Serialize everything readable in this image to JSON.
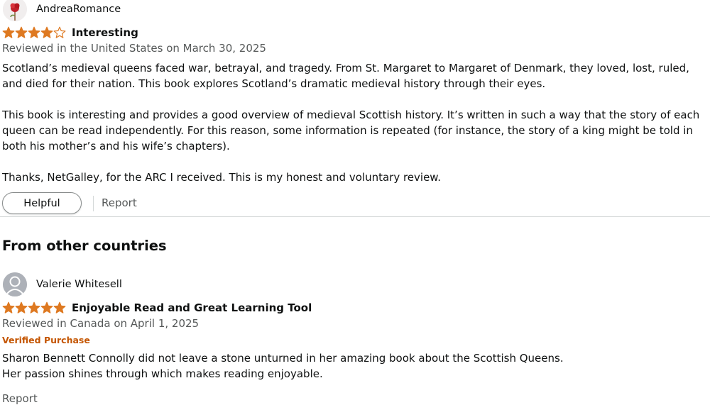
{
  "reviews": [
    {
      "reviewer": "AndreaRomance",
      "rating": 4,
      "max_rating": 5,
      "title": "Interesting",
      "date_line": "Reviewed in the United States on March 30, 2025",
      "paragraphs": [
        "Scotland’s medieval queens faced war, betrayal, and tragedy. From St. Margaret to Margaret of Denmark, they loved, lost, ruled, and died for their nation. This book explores Scotland’s dramatic medieval history through their eyes.",
        "This book is interesting and provides a good overview of medieval Scottish history. It’s written in such a way that the story of each queen can be read independently. For this reason, some information is repeated (for instance, the story of a king might be told in both his mother’s and his wife’s chapters).",
        "Thanks, NetGalley, for the ARC I received. This is my honest and voluntary review."
      ],
      "helpful_label": "Helpful",
      "report_label": "Report"
    },
    {
      "reviewer": "Valerie Whitesell",
      "rating": 5,
      "max_rating": 5,
      "title": "Enjoyable Read and Great Learning Tool",
      "date_line": "Reviewed in Canada on April 1, 2025",
      "badge": "Verified Purchase",
      "paragraphs": [
        "Sharon Bennett Connolly did not leave a stone unturned in her amazing book about the Scottish Queens.",
        "Her passion shines through which makes reading enjoyable."
      ],
      "report_label": "Report"
    }
  ],
  "section_heading": "From other countries",
  "colors": {
    "star": "#de7921",
    "verified": "#c45500",
    "muted_text": "#565959",
    "divider": "#d5d9d9"
  },
  "icons": {
    "avatar_1": "rose-avatar-icon",
    "avatar_2": "default-person-avatar-icon",
    "star_full": "star-filled-icon",
    "star_empty": "star-outline-icon"
  }
}
